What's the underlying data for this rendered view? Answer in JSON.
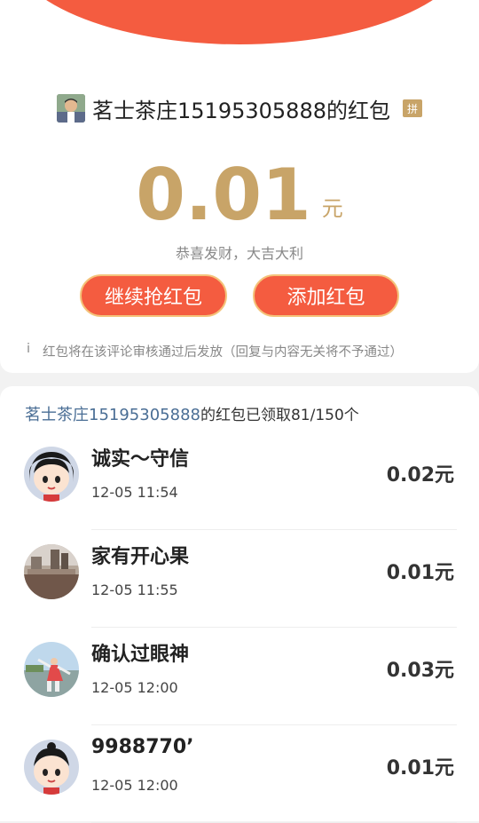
{
  "header": {
    "sender_name": "茗士茶庄15195305888的红包",
    "pin_badge": "拼"
  },
  "amount": {
    "value": "0.01",
    "unit": "元"
  },
  "blessing": "恭喜发财，大吉大利",
  "buttons": {
    "continue_label": "继续抢红包",
    "add_label": "添加红包"
  },
  "notice": {
    "icon": "i",
    "text": "红包将在该评论审核通过后发放（回复与内容无关将不予通过）"
  },
  "summary": {
    "link_name": "茗士茶庄15195305888",
    "suffix": "的红包已领取81/150个"
  },
  "records": [
    {
      "name": "诚实～守信",
      "time": "12-05 11:54",
      "amount": "0.02元",
      "avatar": "cartoon-girl"
    },
    {
      "name": "家有开心果",
      "time": "12-05 11:55",
      "amount": "0.01元",
      "avatar": "city-photo"
    },
    {
      "name": "确认过眼神",
      "time": "12-05 12:00",
      "amount": "0.03元",
      "avatar": "dancer-photo"
    },
    {
      "name": "9988770’",
      "time": "12-05 12:00",
      "amount": "0.01元",
      "avatar": "cartoon-girl"
    }
  ]
}
